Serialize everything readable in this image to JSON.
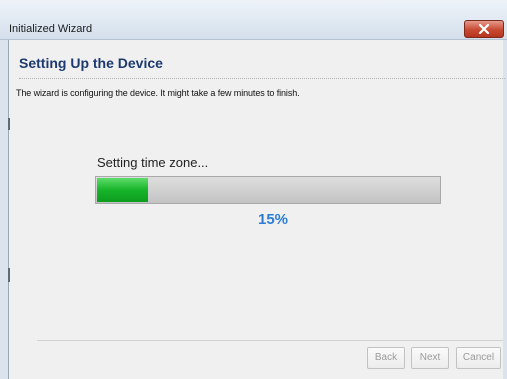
{
  "window": {
    "title": "Initialized Wizard"
  },
  "wizard": {
    "heading": "Setting Up the Device",
    "description": "The wizard is configuring the device. It might take a few minutes to finish.",
    "status_text": "Setting time zone...",
    "progress_percent": 15,
    "progress_label": "15%"
  },
  "buttons": {
    "back_label": "Back",
    "next_label": "Next",
    "cancel_label": "Cancel"
  },
  "colors": {
    "heading": "#1d3a70",
    "percent": "#2a7ed8",
    "progress_fill": "#18b42a"
  },
  "icons": {
    "close": "close-icon"
  }
}
